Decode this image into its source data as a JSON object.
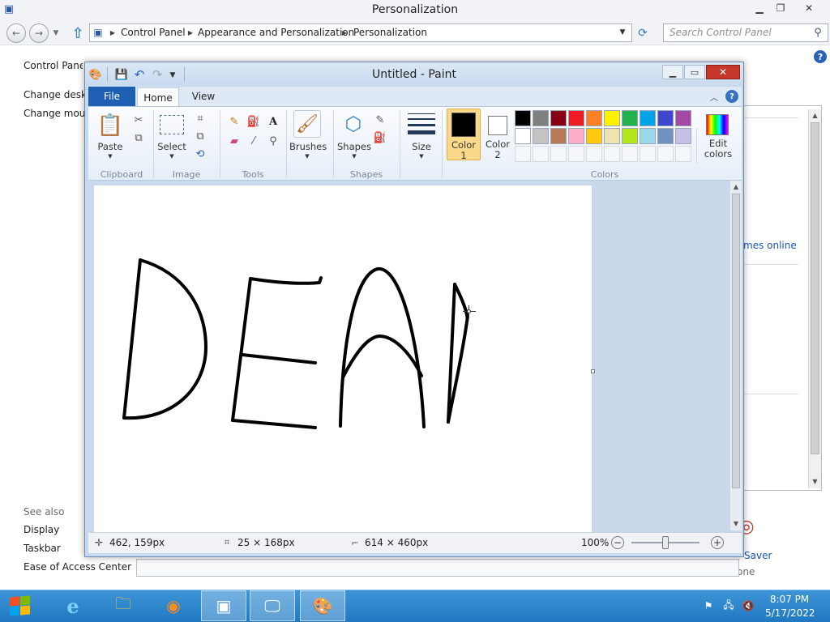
{
  "explorer": {
    "title": "Personalization",
    "breadcrumb": [
      "Control Panel",
      "Appearance and Personalization",
      "Personalization"
    ],
    "search_placeholder": "Search Control Panel",
    "left_nav": {
      "home": "Control Panel",
      "items": [
        "Change deskto",
        "Change mous"
      ],
      "see_also_label": "See also",
      "see_also": [
        "Display",
        "Taskbar",
        "Ease of Access Center"
      ]
    },
    "main_partial": {
      "themes_link": "mes online",
      "saver_label": "Saver",
      "none_label": "one"
    }
  },
  "paint": {
    "title": "Untitled - Paint",
    "tabs": {
      "file": "File",
      "home": "Home",
      "view": "View"
    },
    "groups": {
      "clipboard": "Clipboard",
      "image": "Image",
      "tools": "Tools",
      "shapes": "Shapes",
      "colors": "Colors"
    },
    "buttons": {
      "paste": "Paste",
      "select": "Select",
      "brushes": "Brushes",
      "shapes": "Shapes",
      "size": "Size",
      "color1_line1": "Color",
      "color1_line2": "1",
      "color2_line1": "Color",
      "color2_line2": "2",
      "edit_colors_line1": "Edit",
      "edit_colors_line2": "colors"
    },
    "color1": "#000000",
    "color2": "#ffffff",
    "palette_row1": [
      "#000000",
      "#7f7f7f",
      "#880015",
      "#ed1c24",
      "#ff7f27",
      "#fff200",
      "#22b14c",
      "#00a2e8",
      "#3f48cc",
      "#a349a4"
    ],
    "palette_row2": [
      "#ffffff",
      "#c3c3c3",
      "#b97a57",
      "#ffaec9",
      "#ffc90e",
      "#efe4b0",
      "#b5e61d",
      "#99d9ea",
      "#7092be",
      "#c8bfe7"
    ],
    "status": {
      "cursor_pos": "462, 159px",
      "selection_size": "25 × 168px",
      "canvas_size": "614 × 460px",
      "zoom": "100%"
    },
    "zoom_level": 1.0
  },
  "taskbar": {
    "time": "8:07 PM",
    "date": "5/17/2022",
    "apps": [
      "start-button",
      "internet-explorer",
      "file-explorer",
      "firefox",
      "control-panel",
      "remote-desktop",
      "paint"
    ]
  },
  "colors": {
    "taskbar": "#2b84c8",
    "ribbon_file_tab": "#1e5fb4",
    "close_button": "#c7362b"
  }
}
